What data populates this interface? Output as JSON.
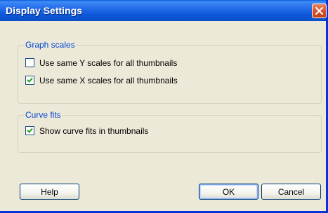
{
  "window": {
    "title": "Display Settings",
    "close_icon": "close-icon"
  },
  "graph_scales": {
    "legend": "Graph scales",
    "options": [
      {
        "label": "Use same Y scales for all thumbnails",
        "checked": false
      },
      {
        "label": "Use same X scales for all thumbnails",
        "checked": true
      }
    ]
  },
  "curve_fits": {
    "legend": "Curve fits",
    "options": [
      {
        "label": "Show curve fits in thumbnails",
        "checked": true
      }
    ]
  },
  "buttons": {
    "help": "Help",
    "ok": "OK",
    "cancel": "Cancel"
  },
  "colors": {
    "title_bar": "#0a5fe0",
    "group_legend": "#0046d5",
    "window_bg": "#ece9d8",
    "check_mark": "#21a121"
  }
}
